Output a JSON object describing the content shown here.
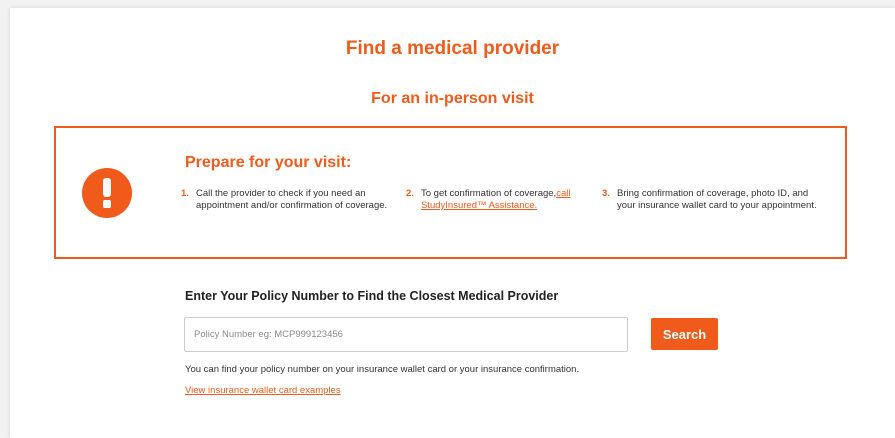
{
  "page": {
    "title": "Find a medical provider",
    "subtitle": "For an in-person visit"
  },
  "notice": {
    "icon": "exclamation-icon",
    "heading": "Prepare for your visit:",
    "steps": [
      {
        "num": "1.",
        "text": "Call the provider to check if you need an appointment and/or confirmation of coverage."
      },
      {
        "num": "2.",
        "text": "To get confirmation of coverage,",
        "link": "call StudyInsured™ Assistance."
      },
      {
        "num": "3.",
        "text": "Bring confirmation of coverage, photo ID, and your insurance wallet card to your appointment."
      }
    ]
  },
  "policy": {
    "heading": "Enter Your Policy Number to Find the Closest Medical Provider",
    "placeholder": "Policy Number eg: MCP999123456",
    "value": "",
    "search_label": "Search",
    "help_text": "You can find your policy number on your insurance wallet card or your insurance confirmation.",
    "wallet_link": "View insurance wallet card examples"
  },
  "colors": {
    "accent": "#f05a1a",
    "text": "#333333",
    "background": "#ffffff"
  }
}
